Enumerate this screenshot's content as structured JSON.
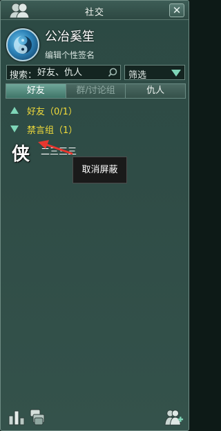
{
  "window": {
    "title": "社交"
  },
  "profile": {
    "name": "公冶奚笙",
    "signature": "编辑个性签名"
  },
  "search": {
    "label": "搜索：",
    "placeholder": "好友、仇人"
  },
  "filter": {
    "label": "筛选"
  },
  "tabs": [
    {
      "label": "好友",
      "state": "active"
    },
    {
      "label": "群/讨论组",
      "state": "disabled"
    },
    {
      "label": "仇人",
      "state": "normal"
    }
  ],
  "groups": [
    {
      "label": "好友（0/1）",
      "expanded": false
    },
    {
      "label": "禁言组（1）",
      "expanded": true
    }
  ],
  "friend": {
    "icon_char": "侠",
    "name": "二三三三"
  },
  "tooltip": {
    "text": "取消屏蔽"
  },
  "colors": {
    "group_label": "#f2dc3a",
    "accent": "#7fd6b8",
    "annotation_arrow": "#e8372f"
  },
  "icons": [
    "social-logo-icon",
    "close-icon",
    "avatar-yinyang-icon",
    "search-icon",
    "dropdown-arrow-icon",
    "ranking-icon",
    "messages-icon",
    "add-friend-icon"
  ]
}
